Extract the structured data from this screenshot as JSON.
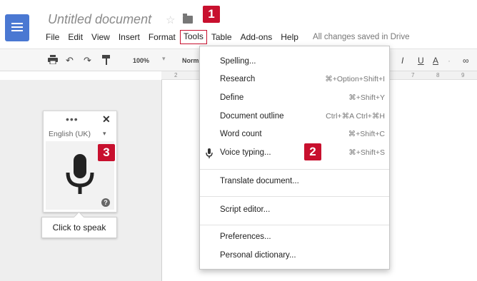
{
  "document": {
    "title": "Untitled document",
    "save_status": "All changes saved in Drive"
  },
  "menubar": {
    "items": [
      "File",
      "Edit",
      "View",
      "Insert",
      "Format",
      "Tools",
      "Table",
      "Add-ons",
      "Help"
    ],
    "active": "Tools"
  },
  "toolbar": {
    "zoom": "100%",
    "style": "Norm",
    "right_format": [
      "I",
      "U",
      "A",
      "·",
      "∞"
    ]
  },
  "ruler": [
    "2",
    "7",
    "8",
    "9"
  ],
  "callouts": {
    "one": "1",
    "two": "2",
    "three": "3"
  },
  "voice_widget": {
    "dots": "•••",
    "close": "✕",
    "language": "English (UK)",
    "help": "?",
    "tooltip": "Click to speak"
  },
  "tools_menu": {
    "items": [
      {
        "label": "Spelling...",
        "shortcut": ""
      },
      {
        "label": "Research",
        "shortcut": "⌘+Option+Shift+I"
      },
      {
        "label": "Define",
        "shortcut": "⌘+Shift+Y"
      },
      {
        "label": "Document outline",
        "shortcut": "Ctrl+⌘A Ctrl+⌘H"
      },
      {
        "label": "Word count",
        "shortcut": "⌘+Shift+C"
      },
      {
        "label": "Voice typing...",
        "shortcut": "⌘+Shift+S"
      },
      {
        "label": "Translate document...",
        "shortcut": ""
      },
      {
        "label": "Script editor...",
        "shortcut": ""
      },
      {
        "label": "Preferences...",
        "shortcut": ""
      },
      {
        "label": "Personal dictionary...",
        "shortcut": ""
      }
    ]
  },
  "colors": {
    "accent": "#c8102e",
    "docs_blue": "#4a78d2"
  }
}
